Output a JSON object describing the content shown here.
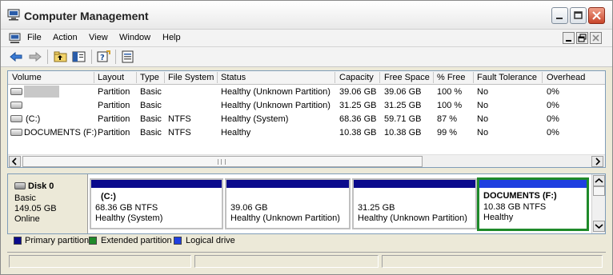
{
  "window": {
    "title": "Computer Management",
    "icon": "computer-management-icon"
  },
  "menu": {
    "items": [
      "File",
      "Action",
      "View",
      "Window",
      "Help"
    ]
  },
  "toolbar": {
    "buttons": [
      "back-arrow-icon",
      "forward-arrow-icon",
      "up-folder-icon",
      "show-hide-tree-icon",
      "help-icon",
      "properties-icon"
    ]
  },
  "volume_list": {
    "columns": [
      "Volume",
      "Layout",
      "Type",
      "File System",
      "Status",
      "Capacity",
      "Free Space",
      "% Free",
      "Fault Tolerance",
      "Overhead"
    ],
    "rows": [
      {
        "volume": "",
        "layout": "Partition",
        "type": "Basic",
        "fs": "",
        "status": "Healthy (Unknown Partition)",
        "capacity": "39.06 GB",
        "free": "39.06 GB",
        "pct": "100 %",
        "fault": "No",
        "overhead": "0%"
      },
      {
        "volume": "",
        "layout": "Partition",
        "type": "Basic",
        "fs": "",
        "status": "Healthy (Unknown Partition)",
        "capacity": "31.25 GB",
        "free": "31.25 GB",
        "pct": "100 %",
        "fault": "No",
        "overhead": "0%"
      },
      {
        "volume": "(C:)",
        "layout": "Partition",
        "type": "Basic",
        "fs": "NTFS",
        "status": "Healthy (System)",
        "capacity": "68.36 GB",
        "free": "59.71 GB",
        "pct": "87 %",
        "fault": "No",
        "overhead": "0%"
      },
      {
        "volume": "DOCUMENTS (F:)",
        "layout": "Partition",
        "type": "Basic",
        "fs": "NTFS",
        "status": "Healthy",
        "capacity": "10.38 GB",
        "free": "10.38 GB",
        "pct": "99 %",
        "fault": "No",
        "overhead": "0%"
      }
    ]
  },
  "disk": {
    "name": "Disk 0",
    "type": "Basic",
    "size": "149.05 GB",
    "state": "Online",
    "partitions": [
      {
        "label": "(C:)",
        "size": "68.36 GB NTFS",
        "status": "Healthy (System)",
        "selected": false
      },
      {
        "label": "",
        "size": "39.06 GB",
        "status": "Healthy (Unknown Partition)",
        "selected": false
      },
      {
        "label": "",
        "size": "31.25 GB",
        "status": "Healthy (Unknown Partition)",
        "selected": false
      },
      {
        "label": "DOCUMENTS  (F:)",
        "size": "10.38 GB NTFS",
        "status": "Healthy",
        "selected": true
      }
    ]
  },
  "legend": {
    "items": [
      {
        "label": "Primary partition",
        "color": "#0a0a8c"
      },
      {
        "label": "Extended partition",
        "color": "#1f8a2a"
      },
      {
        "label": "Logical drive",
        "color": "#1f3fe0"
      }
    ]
  }
}
